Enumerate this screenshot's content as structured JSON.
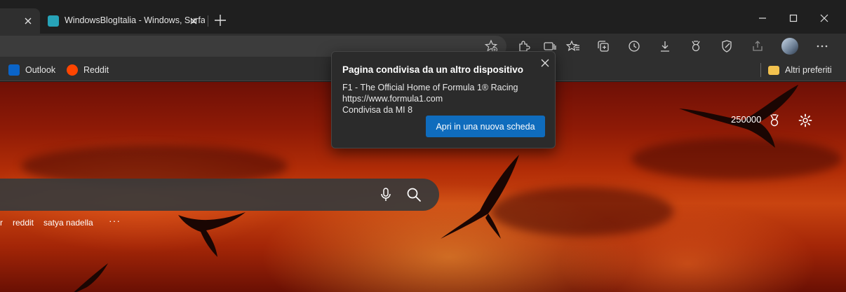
{
  "tabs": [
    {
      "title": "",
      "close_icon": "close-icon"
    },
    {
      "title": "WindowsBlogItalia - Windows, Surface, Xbox",
      "favicon": "windowsblogitalia-favicon",
      "close_icon": "close-icon"
    }
  ],
  "new_tab_icon": "plus-icon",
  "window_controls": [
    "minimize-icon",
    "maximize-icon",
    "close-icon"
  ],
  "toolbar": {
    "icons": [
      "add-favorite-icon",
      "extensions-icon",
      "reading-view-icon",
      "favorites-icon",
      "collections-icon",
      "history-icon",
      "downloads-icon",
      "rewards-icon",
      "performance-icon",
      "share-icon",
      "profile-avatar",
      "more-icon"
    ]
  },
  "favorites_bar": {
    "items": [
      {
        "label": "Outlook",
        "icon": "outlook-icon"
      },
      {
        "label": "Reddit",
        "icon": "reddit-icon"
      }
    ],
    "other_favorites": "Altri preferiti"
  },
  "page": {
    "rewards_points": "250000",
    "trending": [
      "r",
      "reddit",
      "satya nadella"
    ],
    "more": "···"
  },
  "popup": {
    "title": "Pagina condivisa da un altro dispositivo",
    "page_title": "F1 - The Official Home of Formula 1® Racing",
    "url": "https://www.formula1.com",
    "shared_by": "Condivisa da MI 8",
    "button": "Apri in una nuova scheda"
  },
  "colors": {
    "accent": "#0f6cbd",
    "tab_bg": "#2f2f2f",
    "titlebar": "#1f1f1f"
  }
}
